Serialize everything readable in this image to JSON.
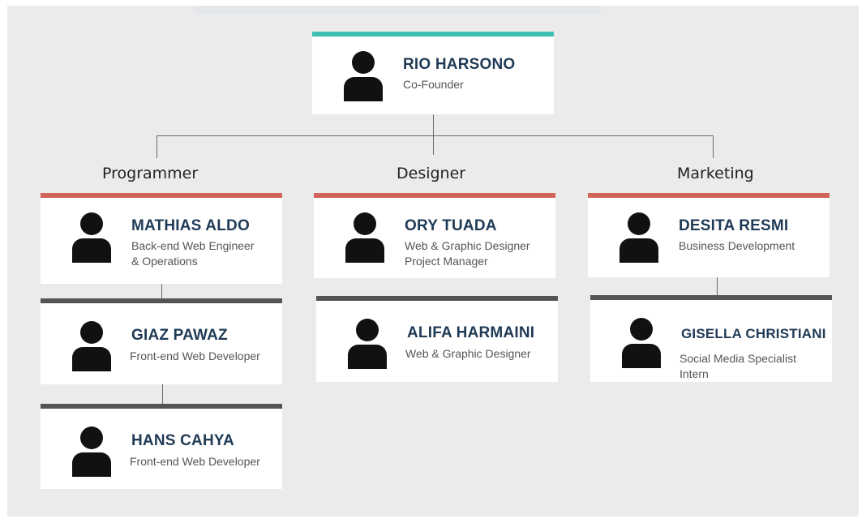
{
  "colors": {
    "background": "#ebebeb",
    "card": "#ffffff",
    "founder_accent": "#3fbfb2",
    "lead_accent": "#d2645a",
    "member_accent": "#555555",
    "name_text": "#1f3a55"
  },
  "icon": "person-icon",
  "founder": {
    "name": "RIO HARSONO",
    "role": "Co-Founder"
  },
  "departments": [
    {
      "label": "Programmer",
      "lead": {
        "name": "MATHIAS ALDO",
        "role_lines": [
          "Back-end Web Engineer",
          "& Operations"
        ]
      },
      "members": [
        {
          "name": "GIAZ PAWAZ",
          "role_lines": [
            "Front-end Web Developer"
          ]
        },
        {
          "name": "HANS CAHYA",
          "role_lines": [
            "Front-end Web Developer"
          ]
        }
      ]
    },
    {
      "label": "Designer",
      "lead": {
        "name": "ORY TUADA",
        "role_lines": [
          "Web & Graphic Designer",
          "Project Manager"
        ]
      },
      "members": [
        {
          "name": "ALIFA HARMAINI",
          "role_lines": [
            "Web & Graphic Designer"
          ]
        }
      ]
    },
    {
      "label": "Marketing",
      "lead": {
        "name": "DESITA RESMI",
        "role_lines": [
          "Business Development"
        ]
      },
      "members": [
        {
          "name": "GISELLA CHRISTIANI",
          "role_lines": [
            "Social Media Specialist",
            "Intern"
          ]
        }
      ]
    }
  ]
}
